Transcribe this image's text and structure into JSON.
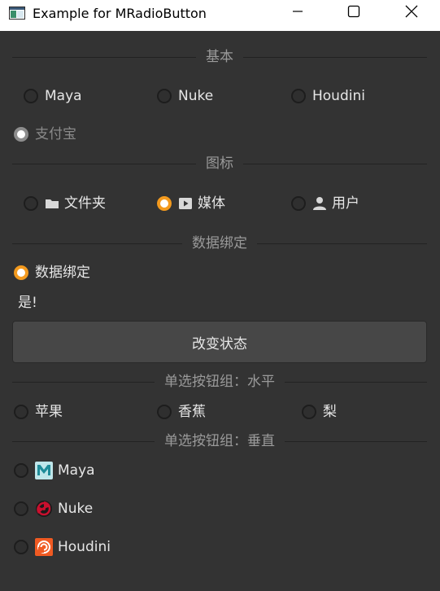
{
  "window": {
    "title": "Example for MRadioButton"
  },
  "sections": {
    "basic": "基本",
    "icon": "图标",
    "data_binding": "数据绑定",
    "group_horizontal": "单选按钮组：水平",
    "group_vertical": "单选按钮组：垂直"
  },
  "basic": {
    "options": [
      {
        "label": "Maya",
        "checked": false
      },
      {
        "label": "Nuke",
        "checked": false
      },
      {
        "label": "Houdini",
        "checked": false
      }
    ],
    "disabled_option": {
      "label": "支付宝",
      "checked": true,
      "enabled": false
    }
  },
  "icon_group": {
    "options": [
      {
        "label": "文件夹",
        "icon": "folder-icon",
        "checked": false
      },
      {
        "label": "媒体",
        "icon": "media-play-icon",
        "checked": true
      },
      {
        "label": "用户",
        "icon": "user-icon",
        "checked": false
      }
    ]
  },
  "data_binding": {
    "radio_label": "数据绑定",
    "radio_checked": true,
    "status_text": "是!",
    "button_label": "改变状态"
  },
  "horizontal_group": {
    "options": [
      {
        "label": "苹果",
        "checked": false
      },
      {
        "label": "香蕉",
        "checked": false
      },
      {
        "label": "梨",
        "checked": false
      }
    ]
  },
  "vertical_group": {
    "options": [
      {
        "label": "Maya",
        "icon": "maya-logo-icon",
        "checked": false
      },
      {
        "label": "Nuke",
        "icon": "nuke-logo-icon",
        "checked": false
      },
      {
        "label": "Houdini",
        "icon": "houdini-logo-icon",
        "checked": false
      }
    ]
  },
  "colors": {
    "background": "#333333",
    "accent": "#f39a1e",
    "text": "#e6e6e6",
    "muted_text": "#9a9a9a"
  }
}
